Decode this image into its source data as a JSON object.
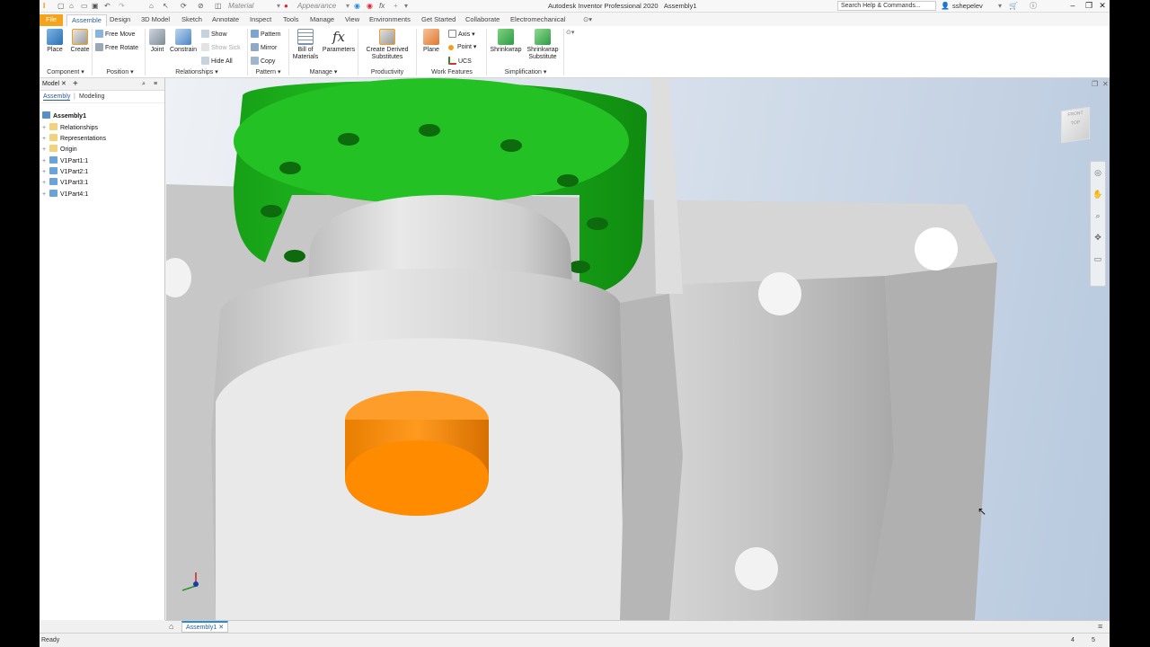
{
  "window": {
    "title": "Autodesk Inventor Professional 2020",
    "document": "Assembly1",
    "search_placeholder": "Search Help & Commands...",
    "user": "sshepelev",
    "quick_access": {
      "material": "Material",
      "appearance": "Appearance"
    }
  },
  "tabs": [
    "File",
    "Assemble",
    "Design",
    "3D Model",
    "Sketch",
    "Annotate",
    "Inspect",
    "Tools",
    "Manage",
    "View",
    "Environments",
    "Get Started",
    "Collaborate",
    "Electromechanical"
  ],
  "active_tab": "Assemble",
  "ribbon": {
    "component": {
      "place": "Place",
      "create": "Create",
      "label": "Component"
    },
    "position": {
      "free_move": "Free Move",
      "free_rotate": "Free Rotate",
      "label": "Position"
    },
    "relationships": {
      "joint": "Joint",
      "constrain": "Constrain",
      "show": "Show",
      "show_sick": "Show Sick",
      "hide_all": "Hide All",
      "label": "Relationships"
    },
    "pattern": {
      "pattern": "Pattern",
      "mirror": "Mirror",
      "copy": "Copy",
      "label": "Pattern"
    },
    "manage": {
      "bom_1": "Bill of",
      "bom_2": "Materials",
      "parameters": "Parameters",
      "label": "Manage"
    },
    "productivity": {
      "cds_1": "Create Derived",
      "cds_2": "Substitutes",
      "label": "Productivity"
    },
    "work_features": {
      "plane": "Plane",
      "axis": "Axis",
      "point": "Point",
      "ucs": "UCS",
      "label": "Work Features"
    },
    "simplification": {
      "shrinkwrap": "Shrinkwrap",
      "ss_1": "Shrinkwrap",
      "ss_2": "Substitute",
      "label": "Simplification"
    }
  },
  "browser": {
    "tab": "Model",
    "subtabs": [
      "Assembly",
      "Modeling"
    ],
    "root": "Assembly1",
    "items": [
      "Relationships",
      "Representations",
      "Origin",
      "V1Part1:1",
      "V1Part2:1",
      "V1Part3:1",
      "V1Part4:1"
    ]
  },
  "viewcube": {
    "front": "FRONT",
    "top": "TOP"
  },
  "document_tab": "Assembly1",
  "status": {
    "text": "Ready",
    "count_a": "4",
    "count_b": "5"
  },
  "colors": {
    "accent": "#f5a31a",
    "green_part": "#1db31d",
    "orange_part": "#ff8c00",
    "grey_part": "#c9c9c9"
  }
}
